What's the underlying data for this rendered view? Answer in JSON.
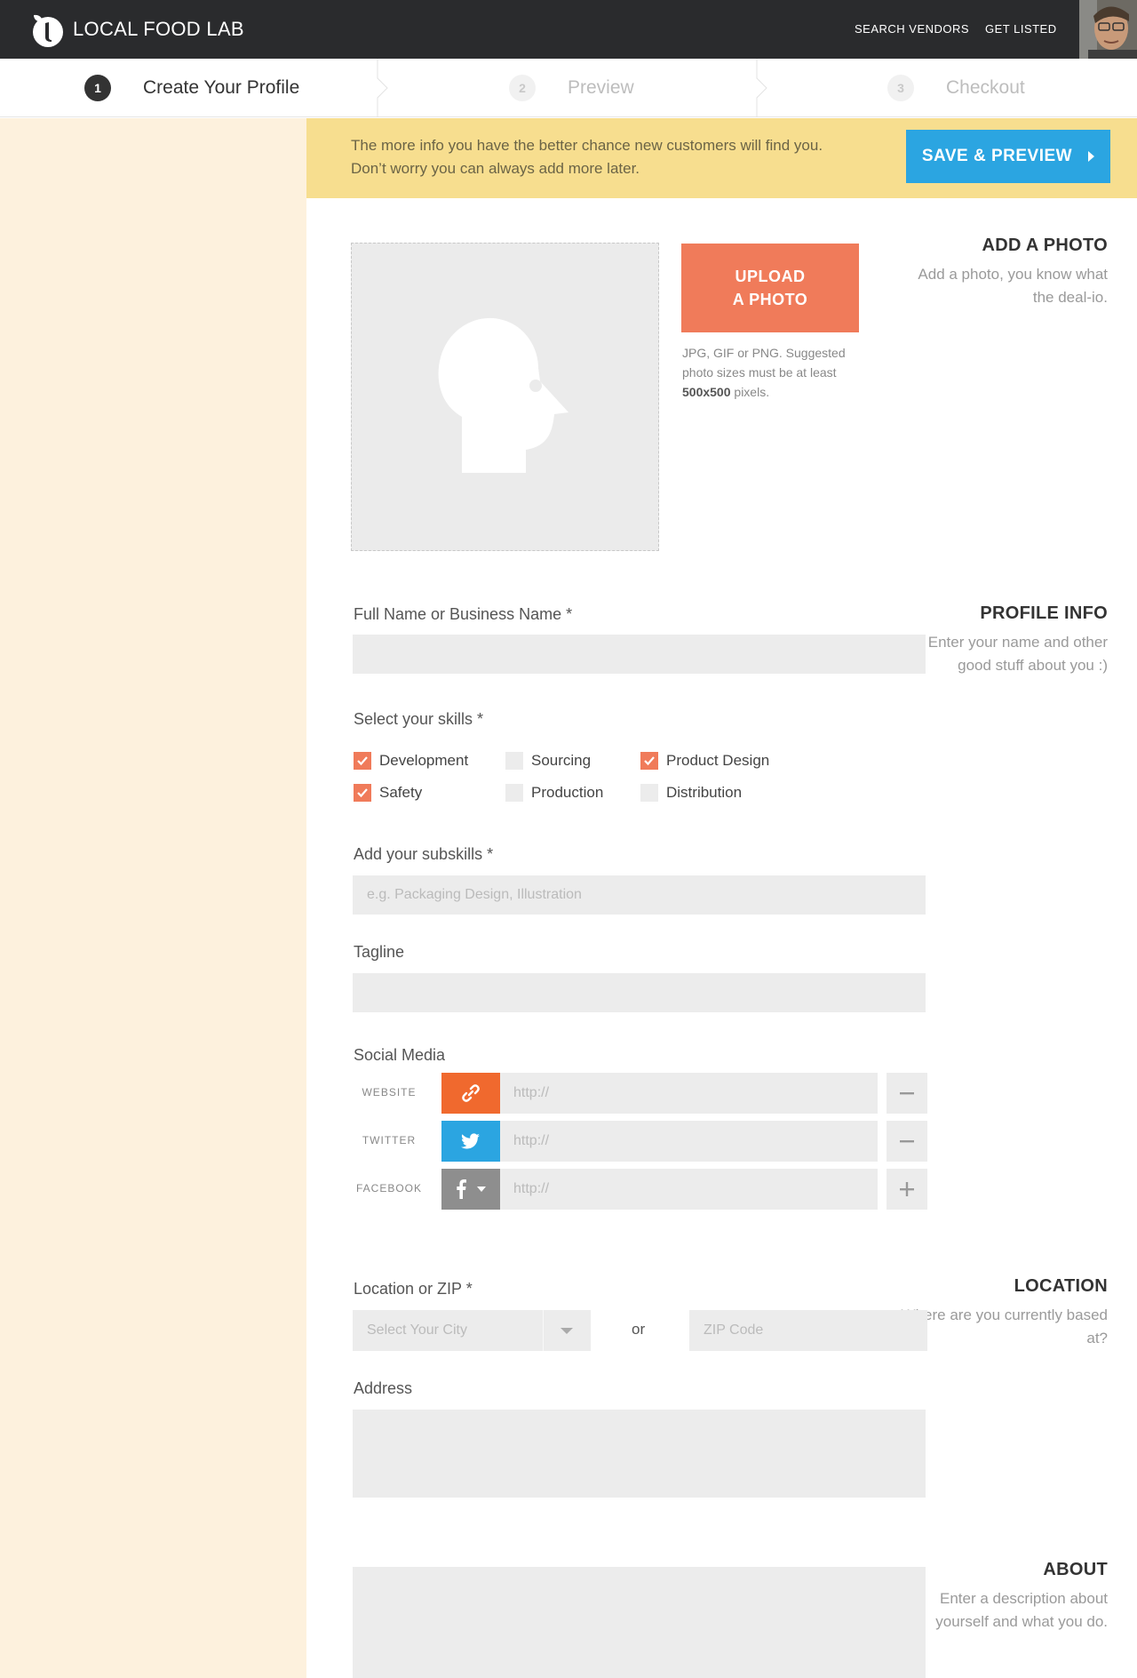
{
  "app": {
    "brand": "LOCAL FOOD LAB",
    "nav": {
      "search_vendors": "SEARCH VENDORS",
      "get_listed": "GET LISTED"
    }
  },
  "steps": [
    {
      "num": "1",
      "label": "Create Your Profile"
    },
    {
      "num": "2",
      "label": "Preview"
    },
    {
      "num": "3",
      "label": "Checkout"
    }
  ],
  "banner": {
    "line1": "The more info you have the better chance new customers will find you.",
    "line2": "Don’t worry you can always add more later.",
    "save_label": "SAVE & PREVIEW"
  },
  "sections": {
    "photo": {
      "title": "ADD A PHOTO",
      "desc": "Add a photo, you know what the deal-io."
    },
    "profile": {
      "title": "PROFILE INFO",
      "desc": "Enter your name and other good stuff about you :)"
    },
    "location": {
      "title": "LOCATION",
      "desc": "Where are you currently based at?"
    },
    "about": {
      "title": "ABOUT",
      "desc": "Enter a description about yourself and what you do."
    }
  },
  "upload": {
    "line1": "UPLOAD",
    "line2": "A PHOTO",
    "note_pre": "JPG, GIF or PNG. Suggested photo sizes must be at least ",
    "note_bold": "500x500",
    "note_post": " pixels."
  },
  "form": {
    "name_label": "Full Name or Business Name *",
    "name_value": "",
    "skills_label": "Select your skills *",
    "skills": [
      {
        "label": "Development",
        "checked": true
      },
      {
        "label": "Sourcing",
        "checked": false
      },
      {
        "label": "Product Design",
        "checked": true
      },
      {
        "label": "Safety",
        "checked": true
      },
      {
        "label": "Production",
        "checked": false
      },
      {
        "label": "Distribution",
        "checked": false
      }
    ],
    "subskills_label": "Add your subskills *",
    "subskills_placeholder": "e.g. Packaging Design, Illustration",
    "tagline_label": "Tagline",
    "tagline_value": "",
    "social_label": "Social Media",
    "social": [
      {
        "name": "WEBSITE",
        "icon": "link-icon",
        "color": "#f0692e",
        "placeholder": "http://",
        "action": "minus-icon"
      },
      {
        "name": "TWITTER",
        "icon": "twitter-icon",
        "color": "#2ba5e1",
        "placeholder": "http://",
        "action": "minus-icon"
      },
      {
        "name": "FACEBOOK",
        "icon": "facebook-icon",
        "color": "#8e8e8e",
        "placeholder": "http://",
        "action": "plus-icon"
      }
    ],
    "location_label": "Location or ZIP *",
    "city_placeholder": "Select Your City",
    "or_text": "or",
    "zip_placeholder": "ZIP Code",
    "address_label": "Address",
    "address_value": "",
    "about_value": ""
  },
  "colors": {
    "accent_orange": "#f07b5a",
    "accent_blue": "#2ba5e1",
    "banner_yellow": "#f7de8f",
    "sidebar_cream": "#fdf1dd",
    "topbar": "#2a2b2d"
  }
}
